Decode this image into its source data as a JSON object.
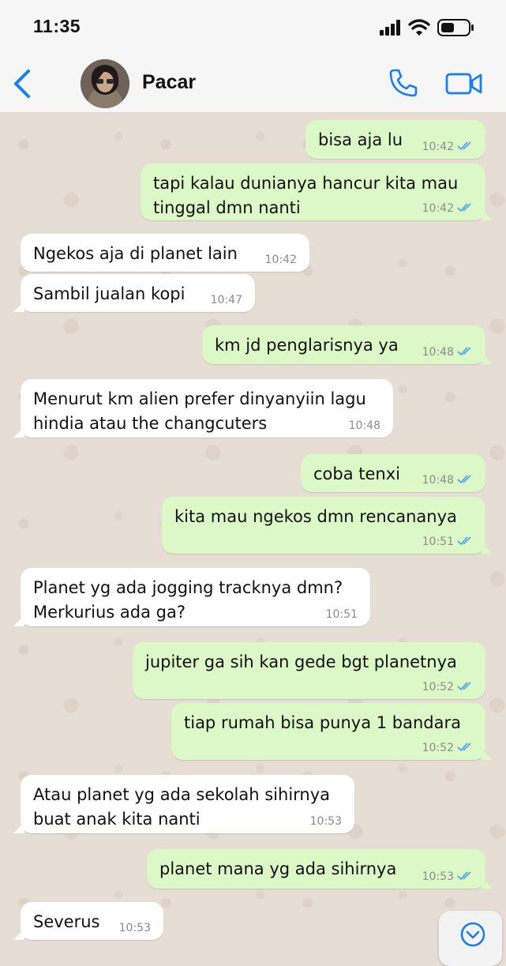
{
  "status_bar": {
    "time": "11:35"
  },
  "header": {
    "contact_name": "Pacar"
  },
  "messages": [
    {
      "dir": "out",
      "lines": [
        "bisa aja lu"
      ],
      "time": "10:42",
      "read": true
    },
    {
      "dir": "out",
      "lines": [
        "tapi kalau dunianya hancur kita mau",
        "tinggal dmn nanti"
      ],
      "time": "10:42",
      "read": true
    },
    {
      "dir": "in",
      "lines": [
        "Ngekos aja di planet lain"
      ],
      "time": "10:42"
    },
    {
      "dir": "in",
      "lines": [
        "Sambil jualan kopi"
      ],
      "time": "10:47"
    },
    {
      "dir": "out",
      "lines": [
        "km jd penglarisnya ya"
      ],
      "time": "10:48",
      "read": true
    },
    {
      "dir": "in",
      "lines": [
        "Menurut km alien prefer dinyanyiin lagu",
        "hindia atau the changcuters"
      ],
      "time": "10:48"
    },
    {
      "dir": "out",
      "lines": [
        "coba tenxi"
      ],
      "time": "10:48",
      "read": true
    },
    {
      "dir": "out",
      "lines": [
        "kita mau ngekos dmn rencananya"
      ],
      "time": "10:51",
      "read": true
    },
    {
      "dir": "in",
      "lines": [
        "Planet yg ada jogging tracknya dmn?",
        "Merkurius ada ga?"
      ],
      "time": "10:51"
    },
    {
      "dir": "out",
      "lines": [
        "jupiter ga sih kan gede bgt planetnya"
      ],
      "time": "10:52",
      "read": true
    },
    {
      "dir": "out",
      "lines": [
        "tiap rumah bisa punya 1 bandara"
      ],
      "time": "10:52",
      "read": true
    },
    {
      "dir": "in",
      "lines": [
        "Atau planet yg ada sekolah sihirnya",
        "buat anak kita nanti"
      ],
      "time": "10:53"
    },
    {
      "dir": "out",
      "lines": [
        "planet mana yg ada sihirnya"
      ],
      "time": "10:53",
      "read": true
    },
    {
      "dir": "in",
      "lines": [
        "Severus"
      ],
      "time": "10:53"
    }
  ],
  "colors": {
    "accent": "#1a7ef0",
    "outgoing_bubble": "#dcf8c6",
    "incoming_bubble": "#ffffff",
    "read_ticks": "#4fa6e8"
  },
  "icons": {
    "back": "chevron-left-icon",
    "call": "phone-icon",
    "video": "video-camera-icon",
    "scroll": "chevron-down-icon"
  }
}
